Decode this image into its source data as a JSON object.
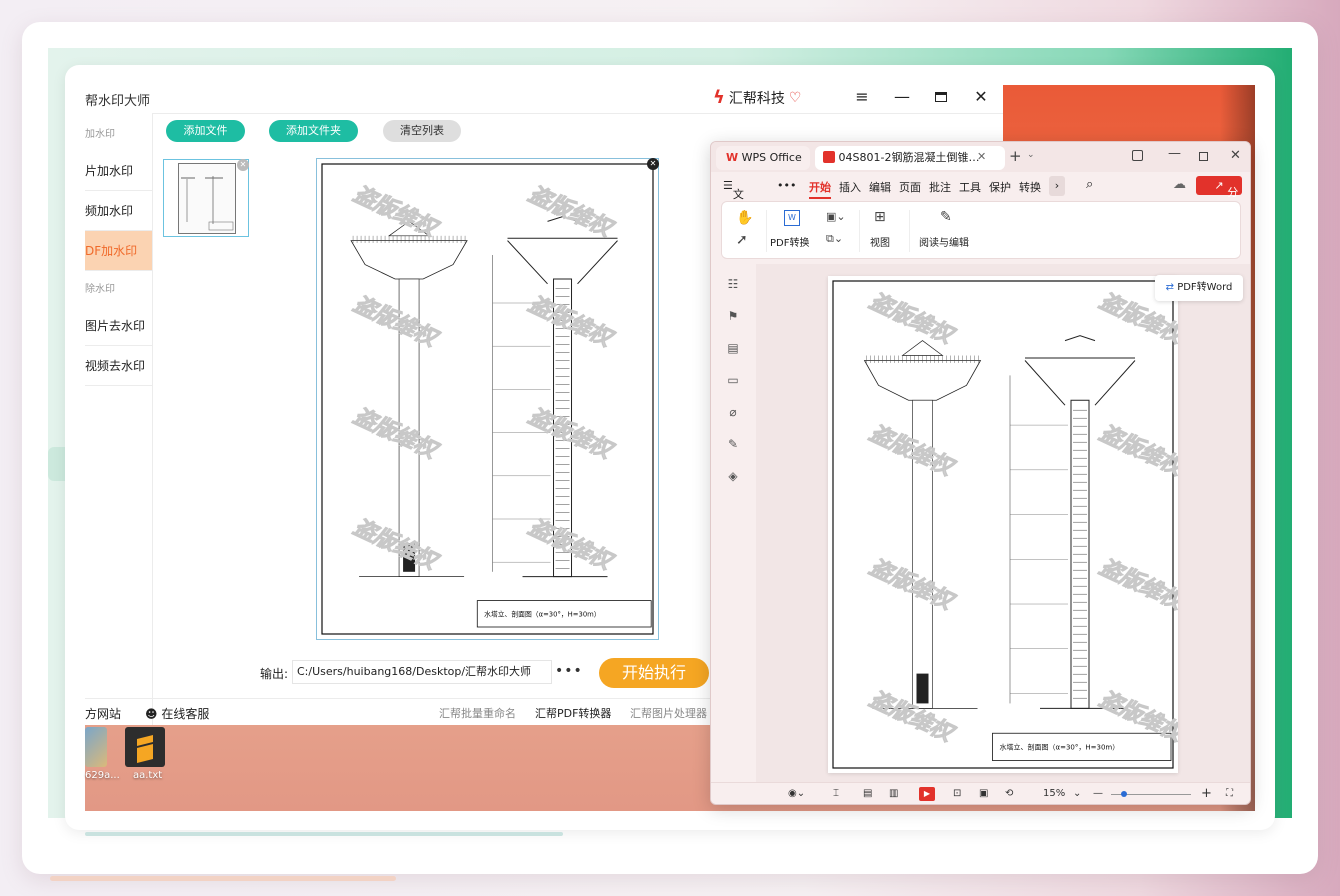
{
  "watermark_app": {
    "title": "帮水印大师",
    "brand": "汇帮科技",
    "sidebar": {
      "cat_add": "加水印",
      "items_add": [
        "片加水印",
        "频加水印",
        "DF加水印"
      ],
      "cat_remove": "除水印",
      "items_remove": [
        "图片去水印",
        "视频去水印"
      ]
    },
    "toolbar": {
      "add_file": "添加文件",
      "add_folder": "添加文件夹",
      "clear_list": "清空列表"
    },
    "output_label": "输出:",
    "output_path": "C:/Users/huibang168/Desktop/汇帮水印大师",
    "output_more": "•••",
    "run_button": "开始执行",
    "footer": {
      "website": "方网站",
      "support": "在线客服",
      "links": [
        "汇帮批量重命名",
        "汇帮PDF转换器",
        "汇帮图片处理器"
      ]
    },
    "watermark_text": "盗版维权"
  },
  "desktop_icons": [
    {
      "label": "629a..."
    },
    {
      "label": "aa.txt"
    }
  ],
  "wps": {
    "tab_app": "WPS Office",
    "tab_doc": "04S801-2钢筋混凝土倒锥…",
    "menu": [
      "文件",
      "开始",
      "插入",
      "编辑",
      "页面",
      "批注",
      "工具",
      "保护",
      "转换"
    ],
    "menu_more": "•••",
    "share": "分享",
    "ribbon": {
      "pdf_convert": "PDF转换",
      "view": "视图",
      "read_edit": "阅读与编辑"
    },
    "pdf_to_word": "PDF转Word",
    "zoom": "15%",
    "drawing_title": "水塔立、剖面图（α=30°，H=30m）"
  }
}
